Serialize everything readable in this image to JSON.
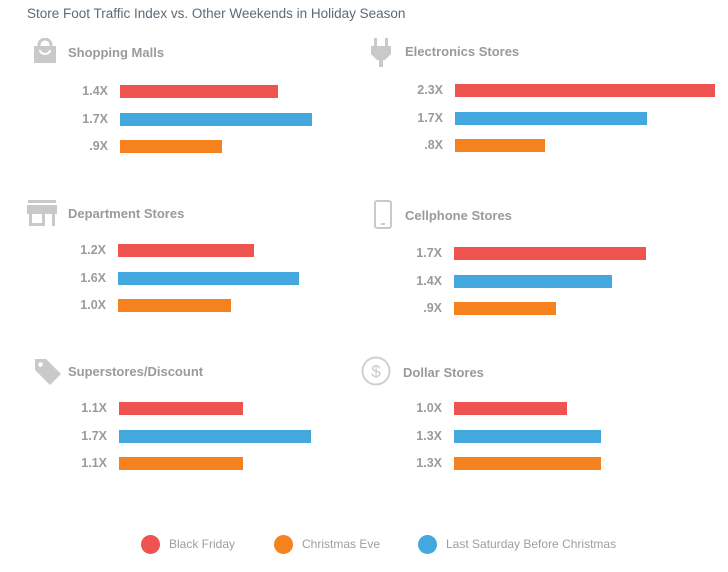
{
  "chart_data": {
    "type": "bar",
    "orientation": "horizontal",
    "title": "Store Foot Traffic Index vs. Other Weekends in Holiday Season",
    "series_names": [
      "Black Friday",
      "Last Saturday Before Christmas",
      "Christmas Eve"
    ],
    "series_colors": {
      "Black Friday": "#ef5350",
      "Last Saturday Before Christmas": "#42a8de",
      "Christmas Eve": "#f5821f"
    },
    "panels": [
      {
        "name": "Shopping Malls",
        "icon": "shopping-bag-icon",
        "values": [
          1.4,
          1.7,
          0.9
        ],
        "labels": [
          "1.4X",
          "1.7X",
          ".9X"
        ]
      },
      {
        "name": "Electronics Stores",
        "icon": "plug-icon",
        "values": [
          2.3,
          1.7,
          0.8
        ],
        "labels": [
          "2.3X",
          "1.7X",
          ".8X"
        ]
      },
      {
        "name": "Department Stores",
        "icon": "storefront-icon",
        "values": [
          1.2,
          1.6,
          1.0
        ],
        "labels": [
          "1.2X",
          "1.6X",
          "1.0X"
        ]
      },
      {
        "name": "Cellphone Stores",
        "icon": "cellphone-icon",
        "values": [
          1.7,
          1.4,
          0.9
        ],
        "labels": [
          "1.7X",
          "1.4X",
          ".9X"
        ]
      },
      {
        "name": "Superstores/Discount",
        "icon": "price-tag-icon",
        "values": [
          1.1,
          1.7,
          1.1
        ],
        "labels": [
          "1.1X",
          "1.7X",
          "1.1X"
        ]
      },
      {
        "name": "Dollar Stores",
        "icon": "dollar-circle-icon",
        "values": [
          1.0,
          1.3,
          1.3
        ],
        "labels": [
          "1.0X",
          "1.3X",
          "1.3X"
        ]
      }
    ],
    "legend": {
      "placement": "bottom",
      "entries": [
        {
          "label": "Black Friday",
          "color": "#ef5350"
        },
        {
          "label": "Christmas Eve",
          "color": "#f5821f"
        },
        {
          "label": "Last Saturday Before Christmas",
          "color": "#42a8de"
        }
      ]
    },
    "xlabel": "",
    "ylabel": "",
    "grid": false
  }
}
